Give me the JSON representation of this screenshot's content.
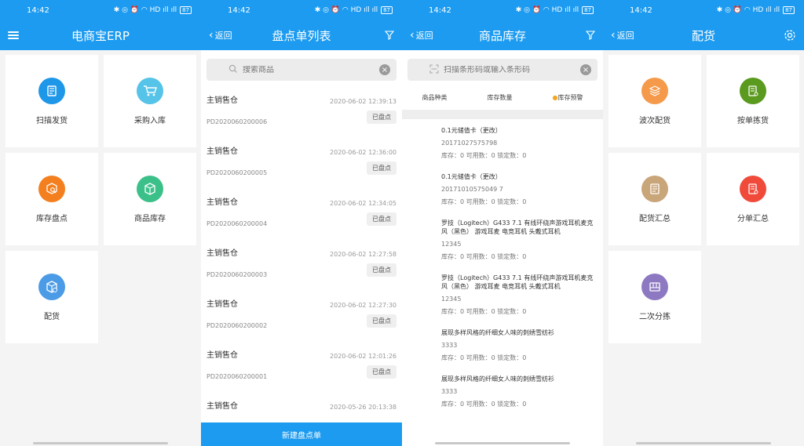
{
  "status": {
    "time": "14:42",
    "icons": "✱ ◎ ⏰ ◠ HD ıll ıll",
    "battery": "87"
  },
  "screen1": {
    "title": "电商宝ERP",
    "tiles": [
      {
        "label": "扫描发货",
        "color": "#1e97e8",
        "icon": "scan-ship-icon"
      },
      {
        "label": "采购入库",
        "color": "#56c3e8",
        "icon": "cart-icon"
      },
      {
        "label": "库存盘点",
        "color": "#f47f1f",
        "icon": "inventory-check-icon"
      },
      {
        "label": "商品库存",
        "color": "#3cc08a",
        "icon": "box-icon"
      },
      {
        "label": "配货",
        "color": "#4b9be6",
        "icon": "package-icon"
      }
    ]
  },
  "screen2": {
    "back": "返回",
    "title": "盘点单列表",
    "search_placeholder": "搜索商品",
    "rows": [
      {
        "warehouse": "主销售仓",
        "date": "2020-06-02 12:39:13",
        "no": "PD2020060200006",
        "status": "已盘点"
      },
      {
        "warehouse": "主销售仓",
        "date": "2020-06-02 12:36:00",
        "no": "PD2020060200005",
        "status": "已盘点"
      },
      {
        "warehouse": "主销售仓",
        "date": "2020-06-02 12:34:05",
        "no": "PD2020060200004",
        "status": "已盘点"
      },
      {
        "warehouse": "主销售仓",
        "date": "2020-06-02 12:27:58",
        "no": "PD2020060200003",
        "status": "已盘点"
      },
      {
        "warehouse": "主销售仓",
        "date": "2020-06-02 12:27:30",
        "no": "PD2020060200002",
        "status": "已盘点"
      },
      {
        "warehouse": "主销售仓",
        "date": "2020-06-02 12:01:26",
        "no": "PD2020060200001",
        "status": "已盘点"
      },
      {
        "warehouse": "主销售仓",
        "date": "2020-05-26 20:13:38",
        "no": "",
        "status": ""
      }
    ],
    "new_button": "新建盘点单"
  },
  "screen3": {
    "back": "返回",
    "title": "商品库存",
    "search_placeholder": "扫描条形码或输入条形码",
    "tabs": [
      "商品种类",
      "库存数量",
      "库存预警"
    ],
    "goods": [
      {
        "name": "0.1元储值卡（更改）",
        "code": "20171027575798",
        "stock": "库存：0 可用数：0 锁定数：0"
      },
      {
        "name": "0.1元储值卡（更改）",
        "code": "20171010575049 7",
        "stock": "库存：0 可用数：0 锁定数：0"
      },
      {
        "name": "罗技（Logitech）G433 7.1 有线环绕声游戏耳机麦克风（黑色） 游戏耳麦 电竞耳机 头戴式耳机",
        "code": "12345",
        "stock": "库存：0 可用数：0 锁定数：0"
      },
      {
        "name": "罗技（Logitech）G433 7.1 有线环绕声游戏耳机麦克风（黑色） 游戏耳麦 电竞耳机 头戴式耳机",
        "code": "12345",
        "stock": "库存：0 可用数：0 锁定数：0"
      },
      {
        "name": "展现多样风格的纤细女人味的刺绣雪纺衫",
        "code": "3333",
        "stock": "库存：0 可用数：0 锁定数：0"
      },
      {
        "name": "展现多样风格的纤细女人味的刺绣雪纺衫",
        "code": "3333",
        "stock": "库存：0 可用数：0 锁定数：0"
      }
    ]
  },
  "screen4": {
    "back": "返回",
    "title": "配货",
    "tiles": [
      {
        "label": "波次配货",
        "color": "#f59a4a",
        "icon": "layers-icon"
      },
      {
        "label": "按单拣货",
        "color": "#5a9a1e",
        "icon": "order-pick-icon"
      },
      {
        "label": "配货汇总",
        "color": "#c9a57a",
        "icon": "summary-icon"
      },
      {
        "label": "分单汇总",
        "color": "#f04a3a",
        "icon": "split-summary-icon"
      },
      {
        "label": "二次分拣",
        "color": "#8d79c2",
        "icon": "sort-icon"
      }
    ]
  }
}
